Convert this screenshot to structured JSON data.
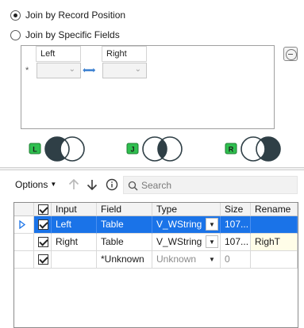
{
  "join_options": {
    "by_position_label": "Join by Record Position",
    "by_fields_label": "Join by Specific Fields",
    "selected": "by_position"
  },
  "fields_box": {
    "star": "*",
    "left_header": "Left",
    "right_header": "Right"
  },
  "venn_labels": {
    "left": "L",
    "join": "J",
    "right": "R"
  },
  "toolbar": {
    "options_label": "Options",
    "search_placeholder": "Search"
  },
  "grid": {
    "columns": [
      "Input",
      "Field",
      "Type",
      "Size",
      "Rename"
    ],
    "rows": [
      {
        "checked": true,
        "input": "Left",
        "field": "Table",
        "type": "V_WString",
        "size": "107...",
        "rename": "",
        "selected": true
      },
      {
        "checked": true,
        "input": "Right",
        "field": "Table",
        "type": "V_WString",
        "size": "107...",
        "rename": "RighT",
        "selected": false
      },
      {
        "checked": true,
        "input": "",
        "field": "*Unknown",
        "type": "Unknown",
        "size": "0",
        "rename": "",
        "selected": false
      }
    ]
  },
  "colors": {
    "selection": "#1a73e8",
    "venn_badge": "#2fbf4f",
    "venn_fill": "#2f3f46"
  }
}
